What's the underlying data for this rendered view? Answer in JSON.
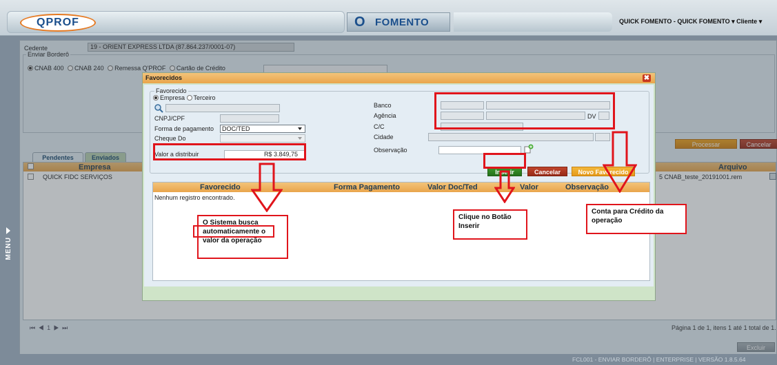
{
  "header": {
    "logo_text": "QPROF",
    "module_icon": "O",
    "module_name": "FOMENTO",
    "user_menu": "QUICK FOMENTO - QUICK FOMENTO ▾   Cliente ▾"
  },
  "side_menu": {
    "label": "MENU"
  },
  "main": {
    "cedente_label": "Cedente",
    "cedente_value": "19 - ORIENT EXPRESS LTDA (87.864.237/0001-07)",
    "bordero_legend": "Enviar Borderô",
    "radio_options": [
      {
        "label": "CNAB 400",
        "checked": true
      },
      {
        "label": "CNAB 240",
        "checked": false
      },
      {
        "label": "Remessa Q'PROF",
        "checked": false
      },
      {
        "label": "Cartão de Crédito",
        "checked": false
      }
    ],
    "processar_label": "Processar",
    "cancelar_label": "Cancelar",
    "tabs": [
      {
        "label": "Pendentes",
        "active": true
      },
      {
        "label": "Enviados",
        "active": false
      }
    ],
    "columns": {
      "empresa": "Empresa",
      "arquivo": "Arquivo"
    },
    "row": {
      "empresa": "QUICK FIDC SERVIÇOS",
      "arquivo": "5 CNAB_teste_20191001.rem"
    },
    "pager_controls": "⏮ ◀ 1 ▶ ⏭",
    "pager_info": "Página 1 de 1, itens 1 até 1 total de 1.",
    "excluir_label": "Excluir"
  },
  "footer": {
    "text": "FCL001 - ENVIAR BORDERÔ | ENTERPRISE | VERSÃO 1.8.5.64"
  },
  "modal": {
    "title": "Favorecidos",
    "close": "✖",
    "fieldset_legend": "Favorecido",
    "radio_options": [
      {
        "label": "Empresa",
        "checked": true
      },
      {
        "label": "Terceiro",
        "checked": false
      }
    ],
    "labels": {
      "cnpj": "CNPJ/CPF",
      "forma_pagamento": "Forma de pagamento",
      "cheque_do": "Cheque Do",
      "valor_distribuir": "Valor a distribuir",
      "banco": "Banco",
      "agencia": "Agência",
      "dv": "DV",
      "cc": "C/C",
      "cidade": "Cidade",
      "observacao": "Observação"
    },
    "forma_pagamento_value": "DOC/TED",
    "valor_distribuir_value": "R$ 3.849,75",
    "inserir_label": "Inserir",
    "cancelar_label": "Cancelar",
    "novo_favorecido_label": "Novo Favorecido",
    "table_headers": [
      "Favorecido",
      "Forma Pagamento",
      "Valor Doc/Ted",
      "Valor",
      "Observação"
    ],
    "empty_text": "Nenhum registro encontrado."
  },
  "annotations": {
    "note_valor": "O Sistema busca automaticamente o valor da operação",
    "note_inserir": "Clique no Botão Inserir",
    "note_conta": "Conta para Crédito da operação",
    "color": "#e0141b"
  }
}
